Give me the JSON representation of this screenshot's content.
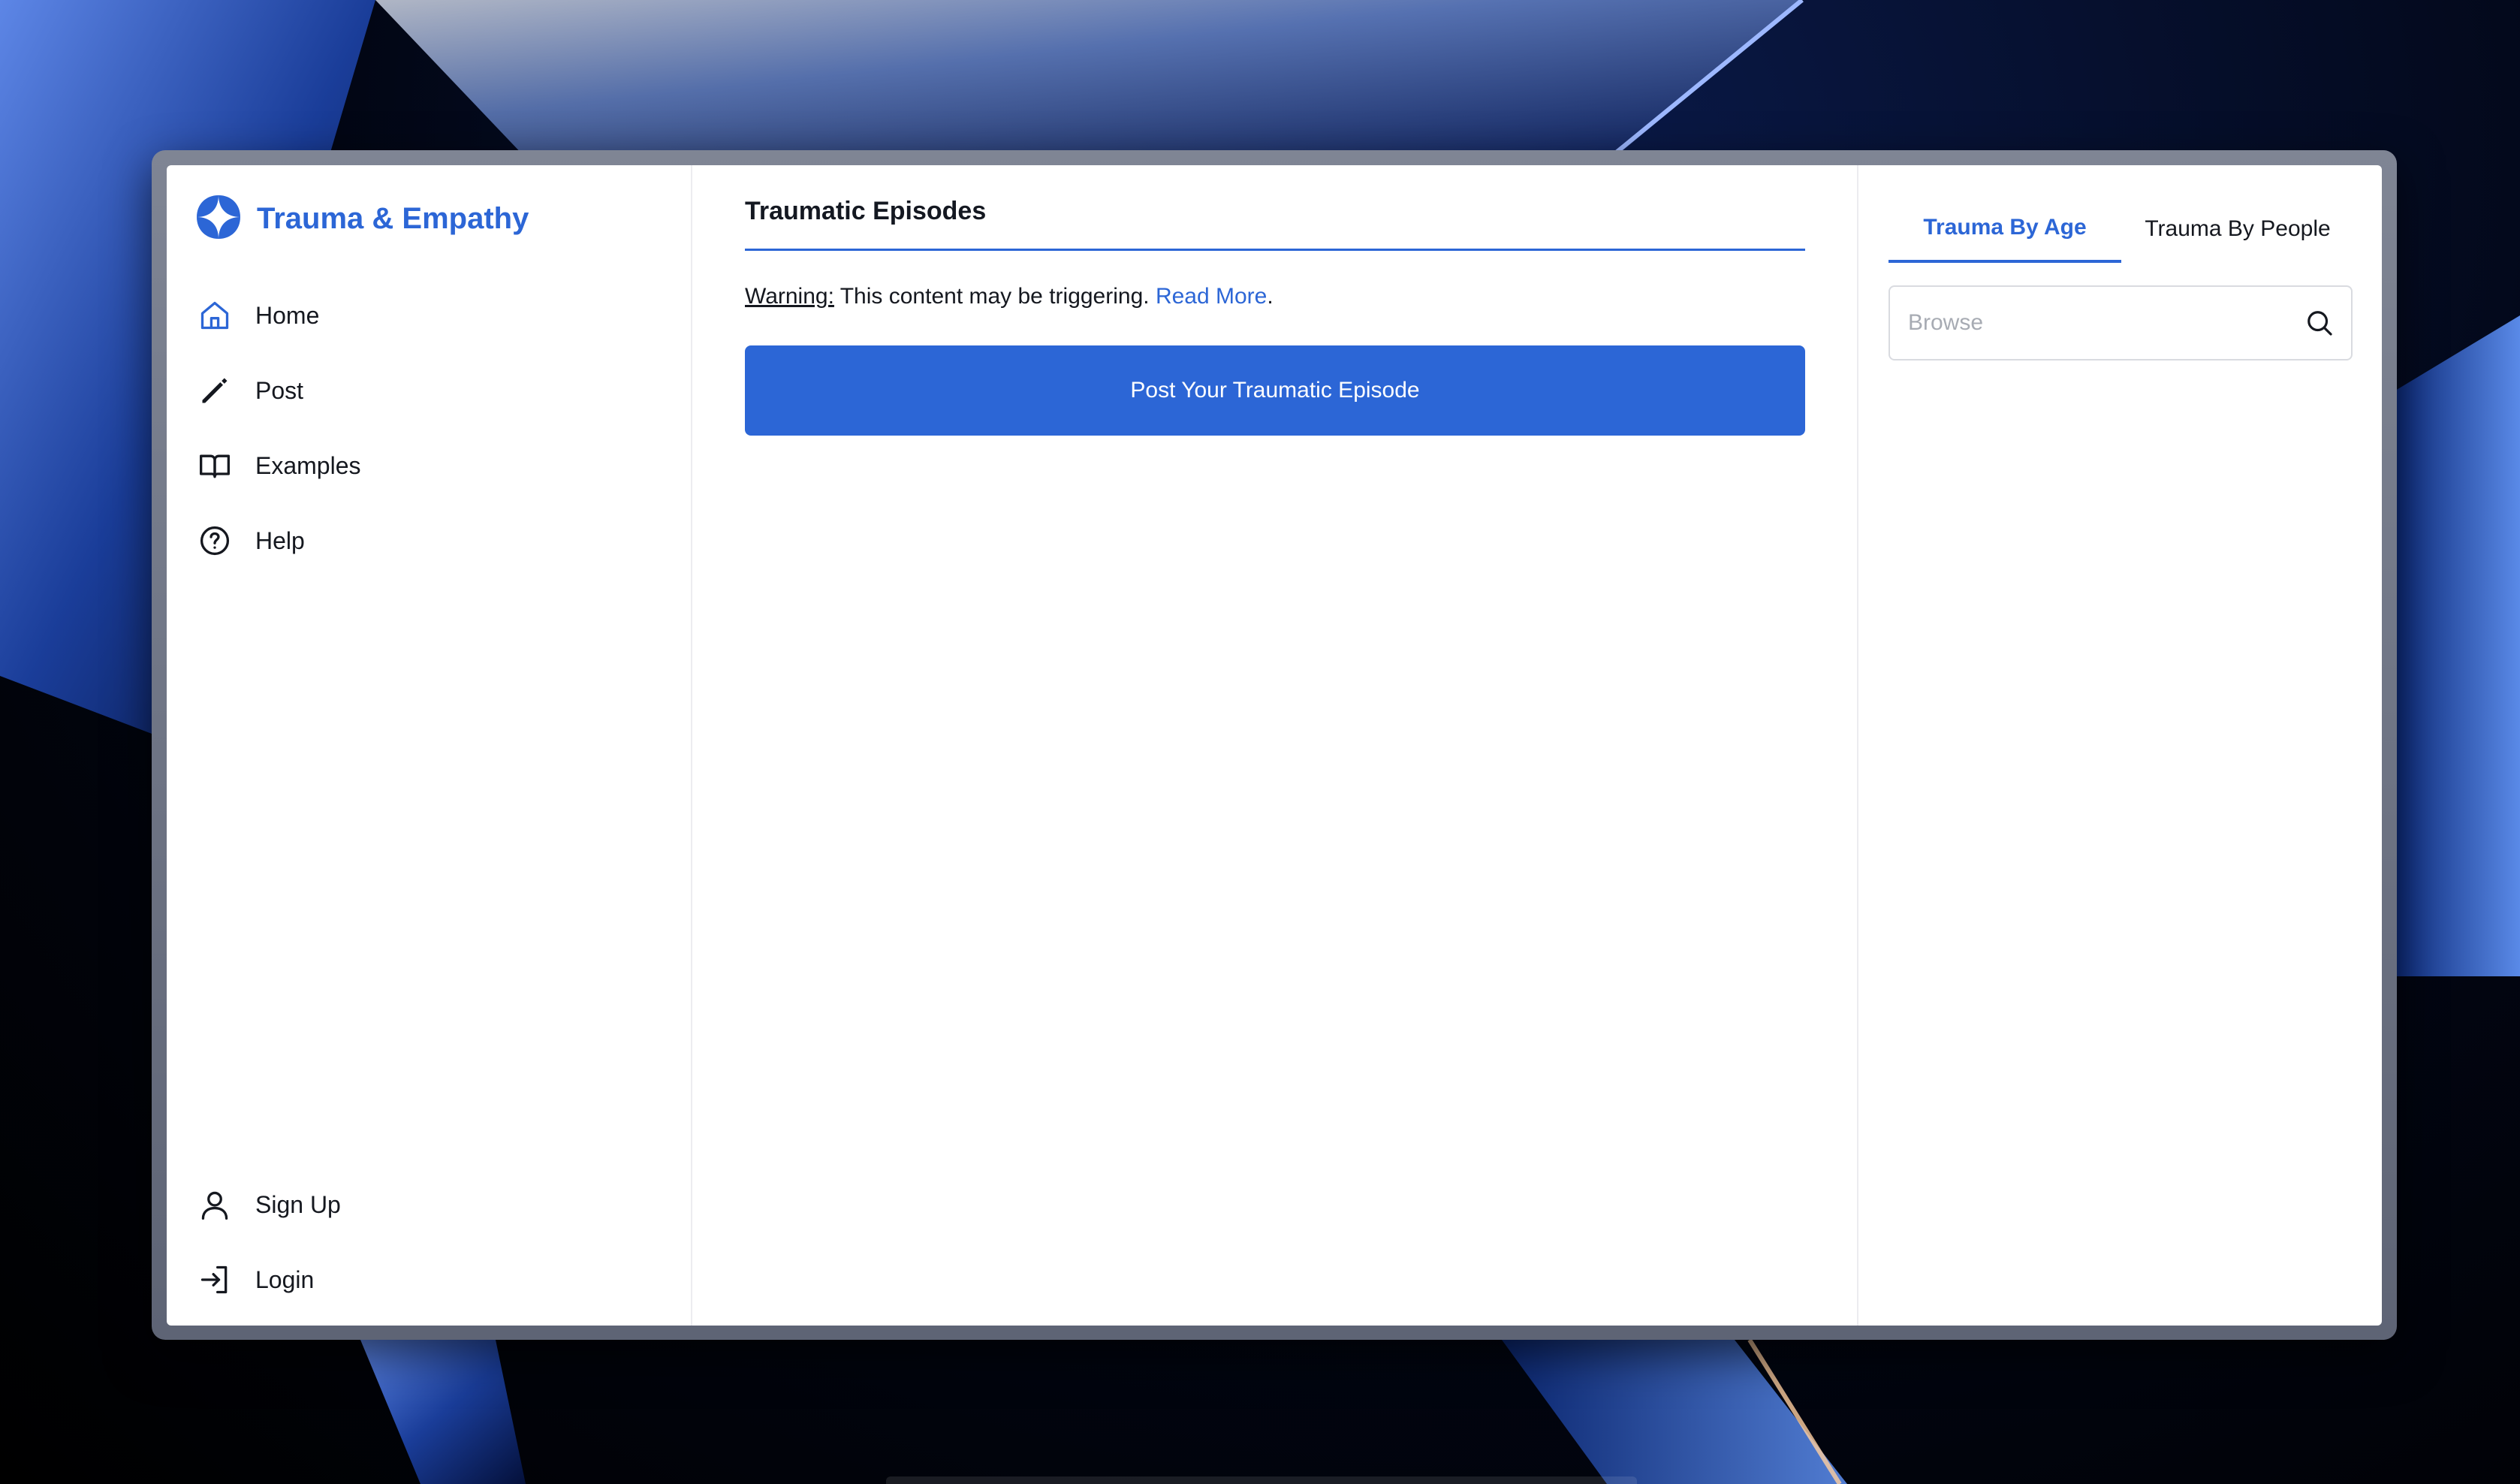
{
  "app": {
    "brand_title": "Trauma & Empathy",
    "accent_color": "#2c66d6"
  },
  "sidebar": {
    "items": [
      {
        "label": "Home",
        "icon": "home-icon"
      },
      {
        "label": "Post",
        "icon": "pencil-icon"
      },
      {
        "label": "Examples",
        "icon": "book-icon"
      },
      {
        "label": "Help",
        "icon": "help-circle-icon"
      }
    ],
    "bottom_items": [
      {
        "label": "Sign Up",
        "icon": "user-icon"
      },
      {
        "label": "Login",
        "icon": "login-icon"
      }
    ]
  },
  "main": {
    "title": "Traumatic Episodes",
    "warning_label": "Warning:",
    "warning_text": "This content may be triggering.",
    "read_more": "Read More",
    "warning_period": ".",
    "post_button": "Post Your Traumatic Episode"
  },
  "right_panel": {
    "tabs": [
      {
        "label": "Trauma By Age",
        "active": true
      },
      {
        "label": "Trauma By People",
        "active": false
      }
    ],
    "search": {
      "placeholder": "Browse",
      "value": "",
      "icon": "search-icon"
    }
  }
}
